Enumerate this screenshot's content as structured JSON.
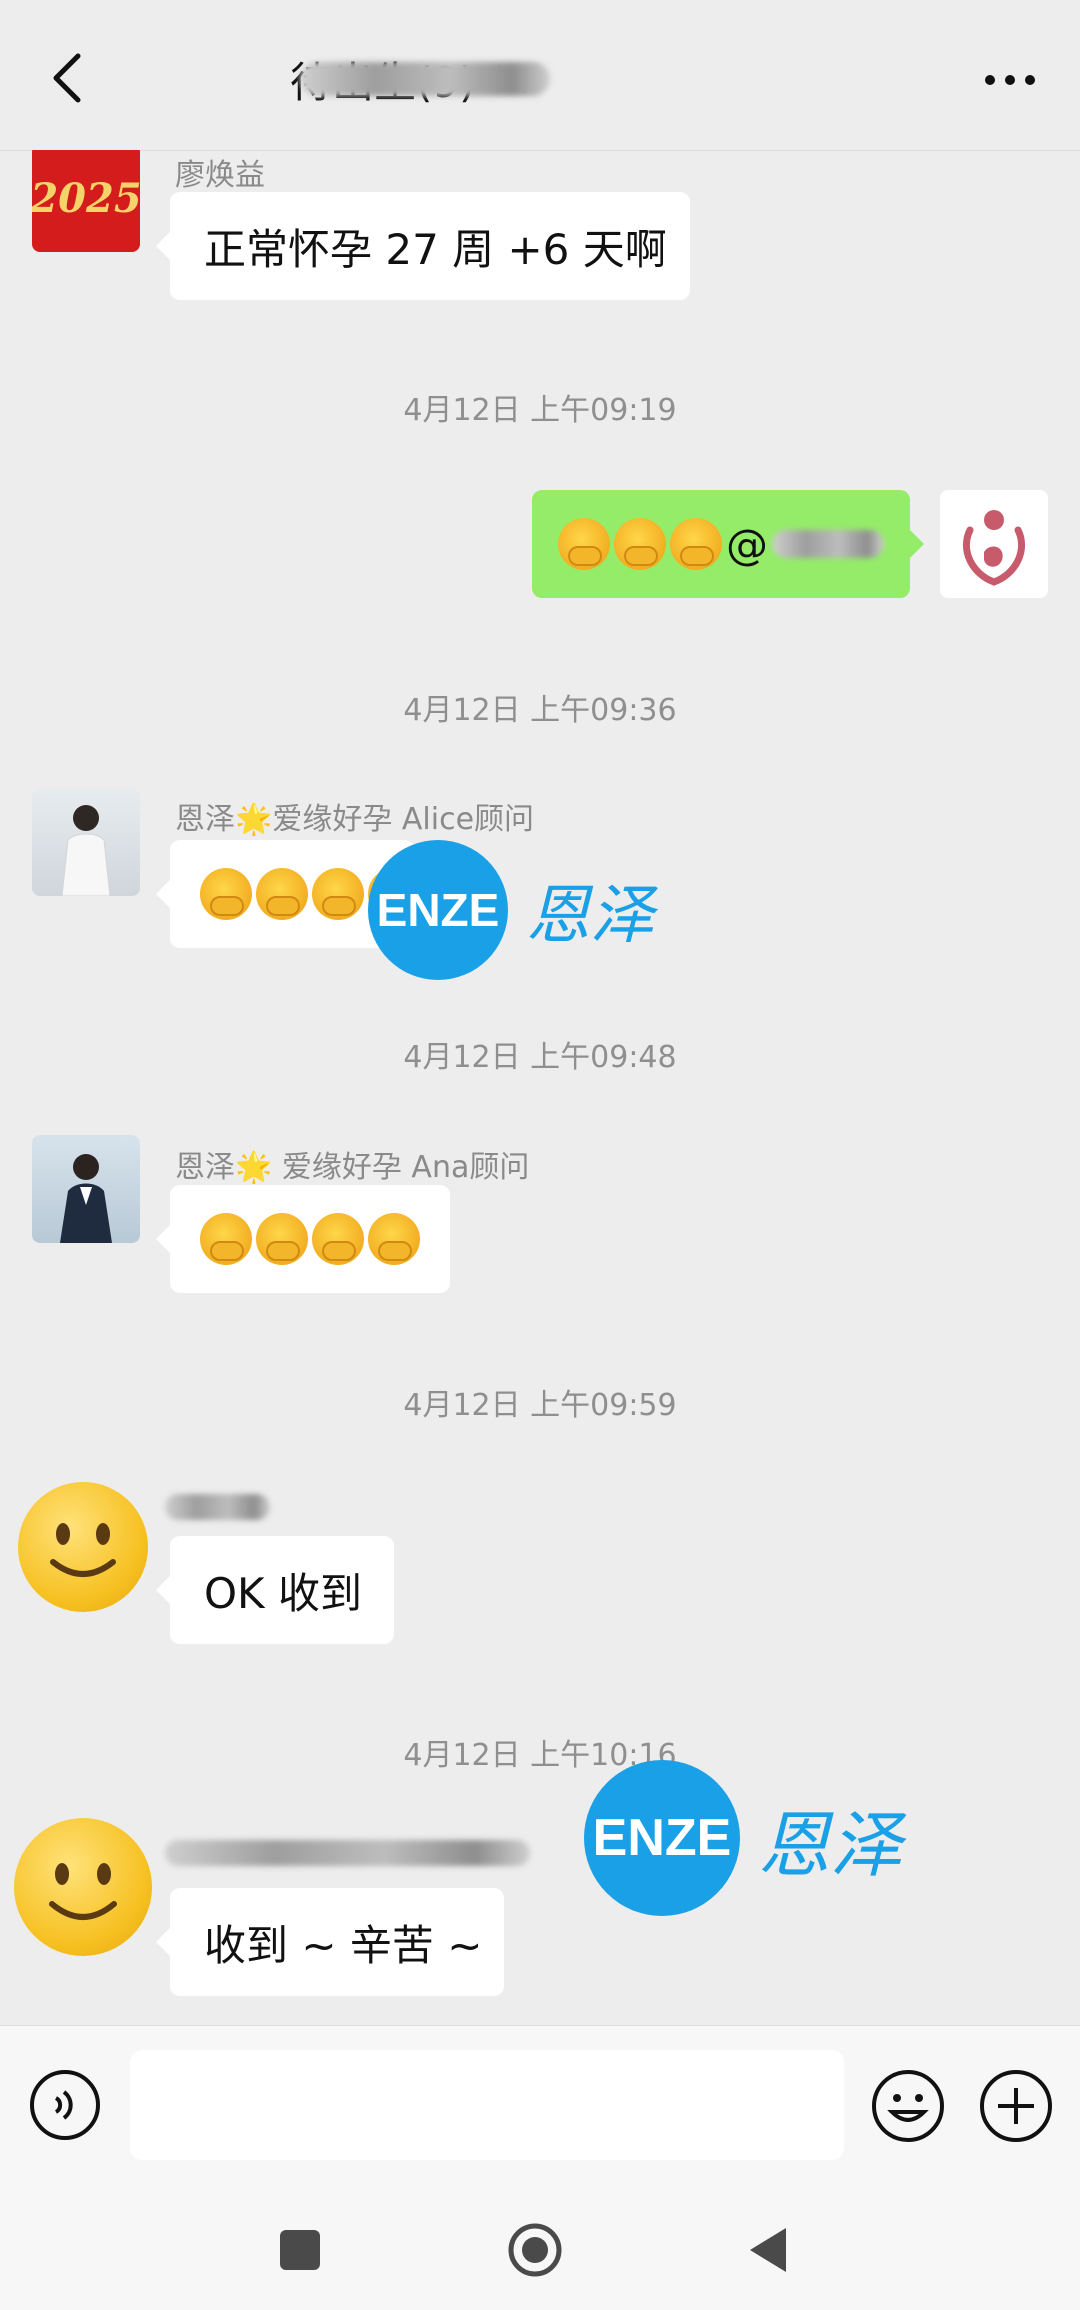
{
  "header": {
    "title": "待出生(9)",
    "back_icon": "chevron-left-icon",
    "mute_icon": "bell-off-icon",
    "more_icon": "more-icon"
  },
  "messages": [
    {
      "sender": "廖焕益",
      "text": "正常怀孕 27 周 +6 天啊"
    },
    {
      "time": "4月12日 上午09:19"
    },
    {
      "mention_prefix": "@"
    },
    {
      "time": "4月12日 上午09:36"
    },
    {
      "sender": "恩泽🌟爱缘好孕 Alice顾问"
    },
    {
      "time": "4月12日 上午09:48"
    },
    {
      "sender": "恩泽🌟 爱缘好孕 Ana顾问"
    },
    {
      "time": "4月12日 上午09:59"
    },
    {
      "text": "OK 收到"
    },
    {
      "time": "4月12日 上午10:16"
    },
    {
      "text": "收到 ~ 辛苦 ~"
    }
  ],
  "avatars": {
    "first": "2025"
  },
  "watermark": {
    "circle_text": "ENZE",
    "side_text": "恩泽"
  },
  "colors": {
    "accent": "#95ec69",
    "watermark": "#1aa0e6",
    "background": "#ededed"
  },
  "input_bar": {
    "voice_icon": "voice-icon",
    "emoji_icon": "emoji-icon",
    "plus_icon": "plus-icon",
    "input_value": ""
  },
  "nav_bar": [
    "square-icon",
    "home-circle-icon",
    "back-triangle-icon"
  ]
}
